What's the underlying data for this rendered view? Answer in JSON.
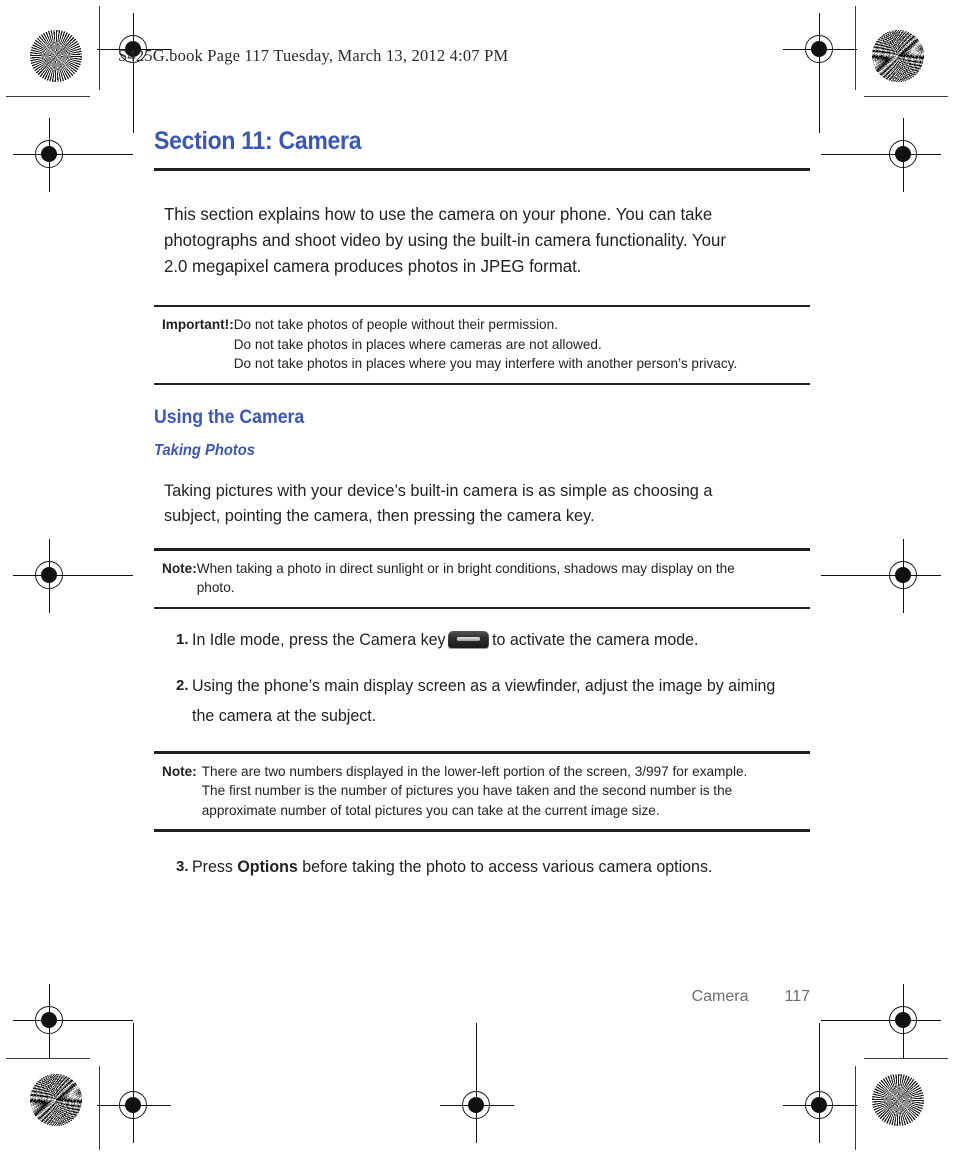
{
  "running_header": "S425G.book  Page 117  Tuesday, March 13, 2012  4:07 PM",
  "section": {
    "title": "Section 11: Camera",
    "intro": "This section explains how to use the camera on your phone. You can take photographs and shoot video by using the built-in camera functionality. Your 2.0 megapixel camera produces photos in JPEG format."
  },
  "important_note": {
    "label": "Important!:",
    "lines": [
      "Do not take photos of people without their permission.",
      "Do not take photos in places where cameras are not allowed.",
      "Do not take photos in places where you may interfere with another person’s privacy."
    ]
  },
  "using_the_camera": {
    "heading": "Using the Camera",
    "subheading": "Taking Photos",
    "paragraph": "Taking pictures with your device’s built-in camera is as simple as choosing a subject, pointing the camera, then pressing the camera key."
  },
  "note_sunlight": {
    "label": "Note:",
    "lines": [
      "When taking a photo in direct sunlight or in bright conditions, shadows may display on the",
      "photo."
    ]
  },
  "steps_group_one": [
    {
      "number": "1.",
      "text_before": "In Idle mode, press the Camera key",
      "icon": "camera-key-icon",
      "text_after": "to activate the camera mode."
    },
    {
      "number": "2.",
      "text_before": "Using the phone’s main display screen as a viewfinder, adjust the image by aiming the camera at the subject.",
      "icon": "",
      "text_after": ""
    }
  ],
  "note_numbers": {
    "label": "Note:",
    "lines": [
      "There are two numbers displayed in the lower-left portion of the screen, 3/997 for example.",
      "The first number is the number of pictures you have taken and the second number is the",
      "approximate number of total pictures you can take at the current image size."
    ]
  },
  "step_three": {
    "number": "3.",
    "text_before": "Press ",
    "bold": "Options",
    "text_after": " before taking the photo to access various camera options."
  },
  "footer": {
    "chapter": "Camera",
    "page_number": "117"
  },
  "colors": {
    "heading_blue": "#3a57b8",
    "body_black": "#231f20",
    "footer_gray": "#6d6d6d"
  }
}
